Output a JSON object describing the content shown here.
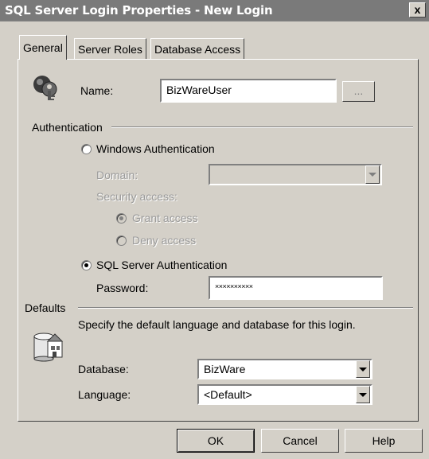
{
  "window": {
    "title": "SQL Server Login Properties - New Login",
    "close_label": "x"
  },
  "tabs": [
    {
      "label": "General"
    },
    {
      "label": "Server Roles"
    },
    {
      "label": "Database Access"
    }
  ],
  "general": {
    "name_label": "Name:",
    "name_value": "BizWareUser",
    "browse_label": "...",
    "authentication_heading": "Authentication",
    "windows_auth_label": "Windows Authentication",
    "domain_label": "Domain:",
    "domain_value": "",
    "security_access_label": "Security access:",
    "grant_access_label": "Grant access",
    "deny_access_label": "Deny access",
    "sql_auth_label": "SQL Server Authentication",
    "password_label": "Password:",
    "password_value": "××××××××××",
    "defaults_heading": "Defaults",
    "defaults_description": "Specify the default language and database for this login.",
    "database_label": "Database:",
    "database_value": "BizWare",
    "language_label": "Language:",
    "language_value": "<Default>"
  },
  "buttons": {
    "ok": "OK",
    "cancel": "Cancel",
    "help": "Help"
  },
  "state": {
    "selected_tab": "General",
    "authentication_mode": "SQL Server Authentication",
    "security_access": "Grant access"
  }
}
